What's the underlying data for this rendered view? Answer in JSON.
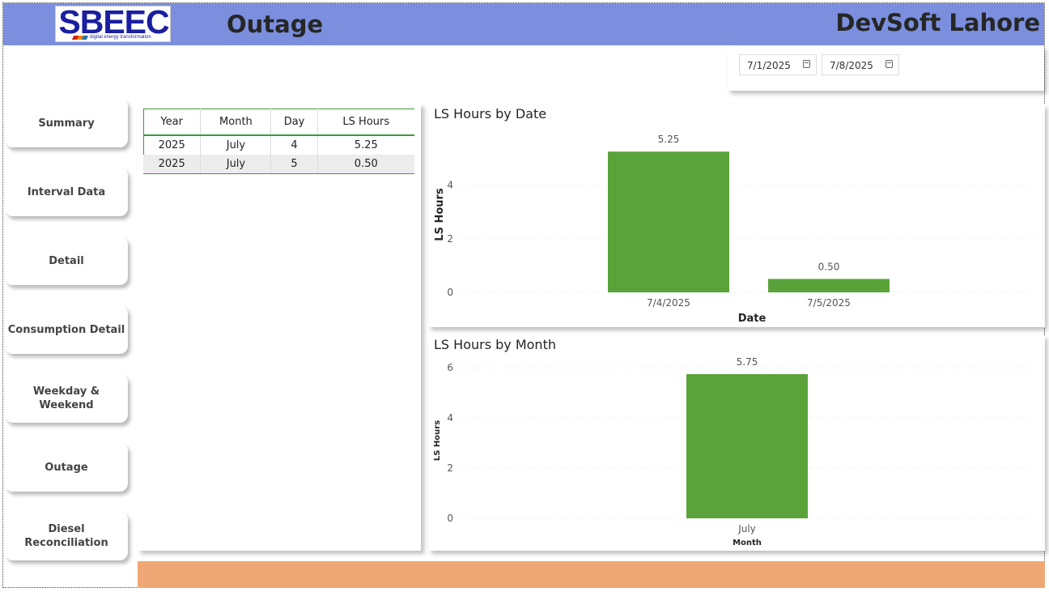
{
  "header": {
    "logo_text": "SBEEC",
    "logo_subtitle": "digital energy transformation",
    "page_title": "Outage",
    "company": "DevSoft Lahore",
    "background": "#7b8fde"
  },
  "date_filter": {
    "start": "7/1/2025",
    "end": "7/8/2025"
  },
  "nav": [
    {
      "label": "Summary"
    },
    {
      "label": "Interval Data"
    },
    {
      "label": "Detail"
    },
    {
      "label": "Consumption Detail"
    },
    {
      "label": "Weekday & Weekend"
    },
    {
      "label": "Outage"
    },
    {
      "label": "Diesel Reconciliation"
    }
  ],
  "table": {
    "columns": [
      "Year",
      "Month",
      "Day",
      "LS Hours"
    ],
    "rows": [
      [
        "2025",
        "July",
        "4",
        "5.25"
      ],
      [
        "2025",
        "July",
        "5",
        "0.50"
      ]
    ]
  },
  "chart_data": [
    {
      "type": "bar",
      "title": "LS Hours by Date",
      "xlabel": "Date",
      "ylabel": "LS Hours",
      "categories": [
        "7/4/2025",
        "7/5/2025"
      ],
      "values": [
        5.25,
        0.5
      ],
      "data_labels": [
        "5.25",
        "0.50"
      ],
      "yticks": [
        "0",
        "2",
        "4"
      ],
      "ylim": [
        0,
        5.8
      ],
      "color": "#5aa33a",
      "grid": true
    },
    {
      "type": "bar",
      "title": "LS Hours by Month",
      "xlabel": "Month",
      "ylabel": "LS Hours",
      "categories": [
        "July"
      ],
      "values": [
        5.75
      ],
      "data_labels": [
        "5.75"
      ],
      "yticks": [
        "0",
        "2",
        "4",
        "6"
      ],
      "ylim": [
        0,
        6.2
      ],
      "color": "#5aa33a",
      "grid": true
    }
  ],
  "footer": {
    "color": "#efa776"
  }
}
